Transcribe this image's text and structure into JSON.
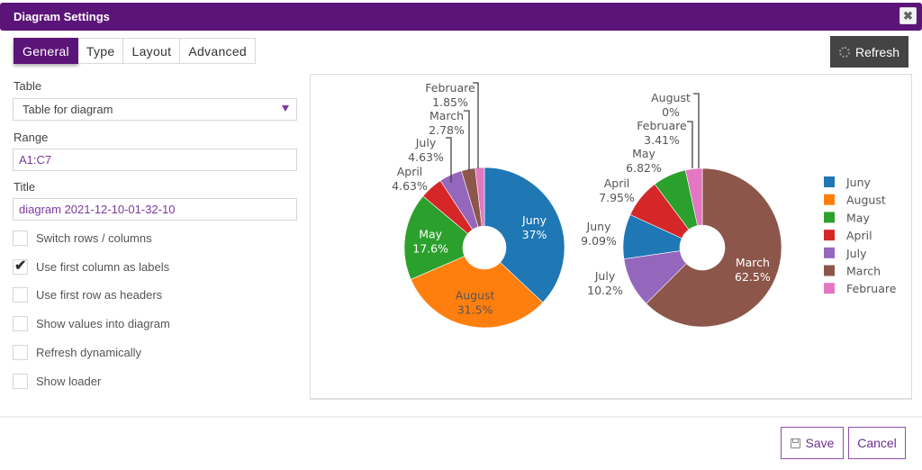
{
  "dialog": {
    "title": "Diagram Settings",
    "close_icon": "close-icon"
  },
  "tabs": [
    {
      "label": "General",
      "active": true
    },
    {
      "label": "Type",
      "active": false
    },
    {
      "label": "Layout",
      "active": false
    },
    {
      "label": "Advanced",
      "active": false
    }
  ],
  "toolbar": {
    "refresh_label": "Refresh",
    "refresh_icon": "spinner-icon"
  },
  "form": {
    "table_label": "Table",
    "table_value": "Table for diagram",
    "range_label": "Range",
    "range_value": "A1:C7",
    "title_label": "Title",
    "title_value": "diagram 2021-12-10-01-32-10",
    "checkboxes": [
      {
        "label": "Switch rows / columns",
        "checked": false
      },
      {
        "label": "Use first column as labels",
        "checked": true
      },
      {
        "label": "Use first row as headers",
        "checked": false
      },
      {
        "label": "Show values into diagram",
        "checked": false
      },
      {
        "label": "Refresh dynamically",
        "checked": false
      },
      {
        "label": "Show loader",
        "checked": false
      }
    ]
  },
  "footer": {
    "save_label": "Save",
    "cancel_label": "Cancel",
    "save_icon": "floppy-disk-icon"
  },
  "colors": {
    "accent": "#5b1478",
    "Juny": "#1f77b4",
    "August": "#ff7f0e",
    "May": "#2ca02c",
    "April": "#d62728",
    "July": "#9467bd",
    "March": "#8c564b",
    "Februare": "#e377c2"
  },
  "chart_data": {
    "type": "pie",
    "hole": true,
    "legend_placement": "right",
    "legend": [
      "Juny",
      "August",
      "May",
      "April",
      "July",
      "March",
      "Februare"
    ],
    "series": [
      {
        "name": "pie-1",
        "labels": [
          "Juny",
          "August",
          "May",
          "April",
          "July",
          "March",
          "Februare"
        ],
        "percent": [
          37,
          31.5,
          17.6,
          4.63,
          4.63,
          2.78,
          1.85
        ],
        "percent_labels": [
          "37%",
          "31.5%",
          "17.6%",
          "4.63%",
          "4.63%",
          "2.78%",
          "1.85%"
        ]
      },
      {
        "name": "pie-2",
        "labels": [
          "March",
          "July",
          "Juny",
          "April",
          "May",
          "Februare",
          "August"
        ],
        "percent": [
          62.5,
          10.2,
          9.09,
          7.95,
          6.82,
          3.41,
          0
        ],
        "percent_labels": [
          "62.5%",
          "10.2%",
          "9.09%",
          "7.95%",
          "6.82%",
          "3.41%",
          "0%"
        ]
      }
    ]
  }
}
